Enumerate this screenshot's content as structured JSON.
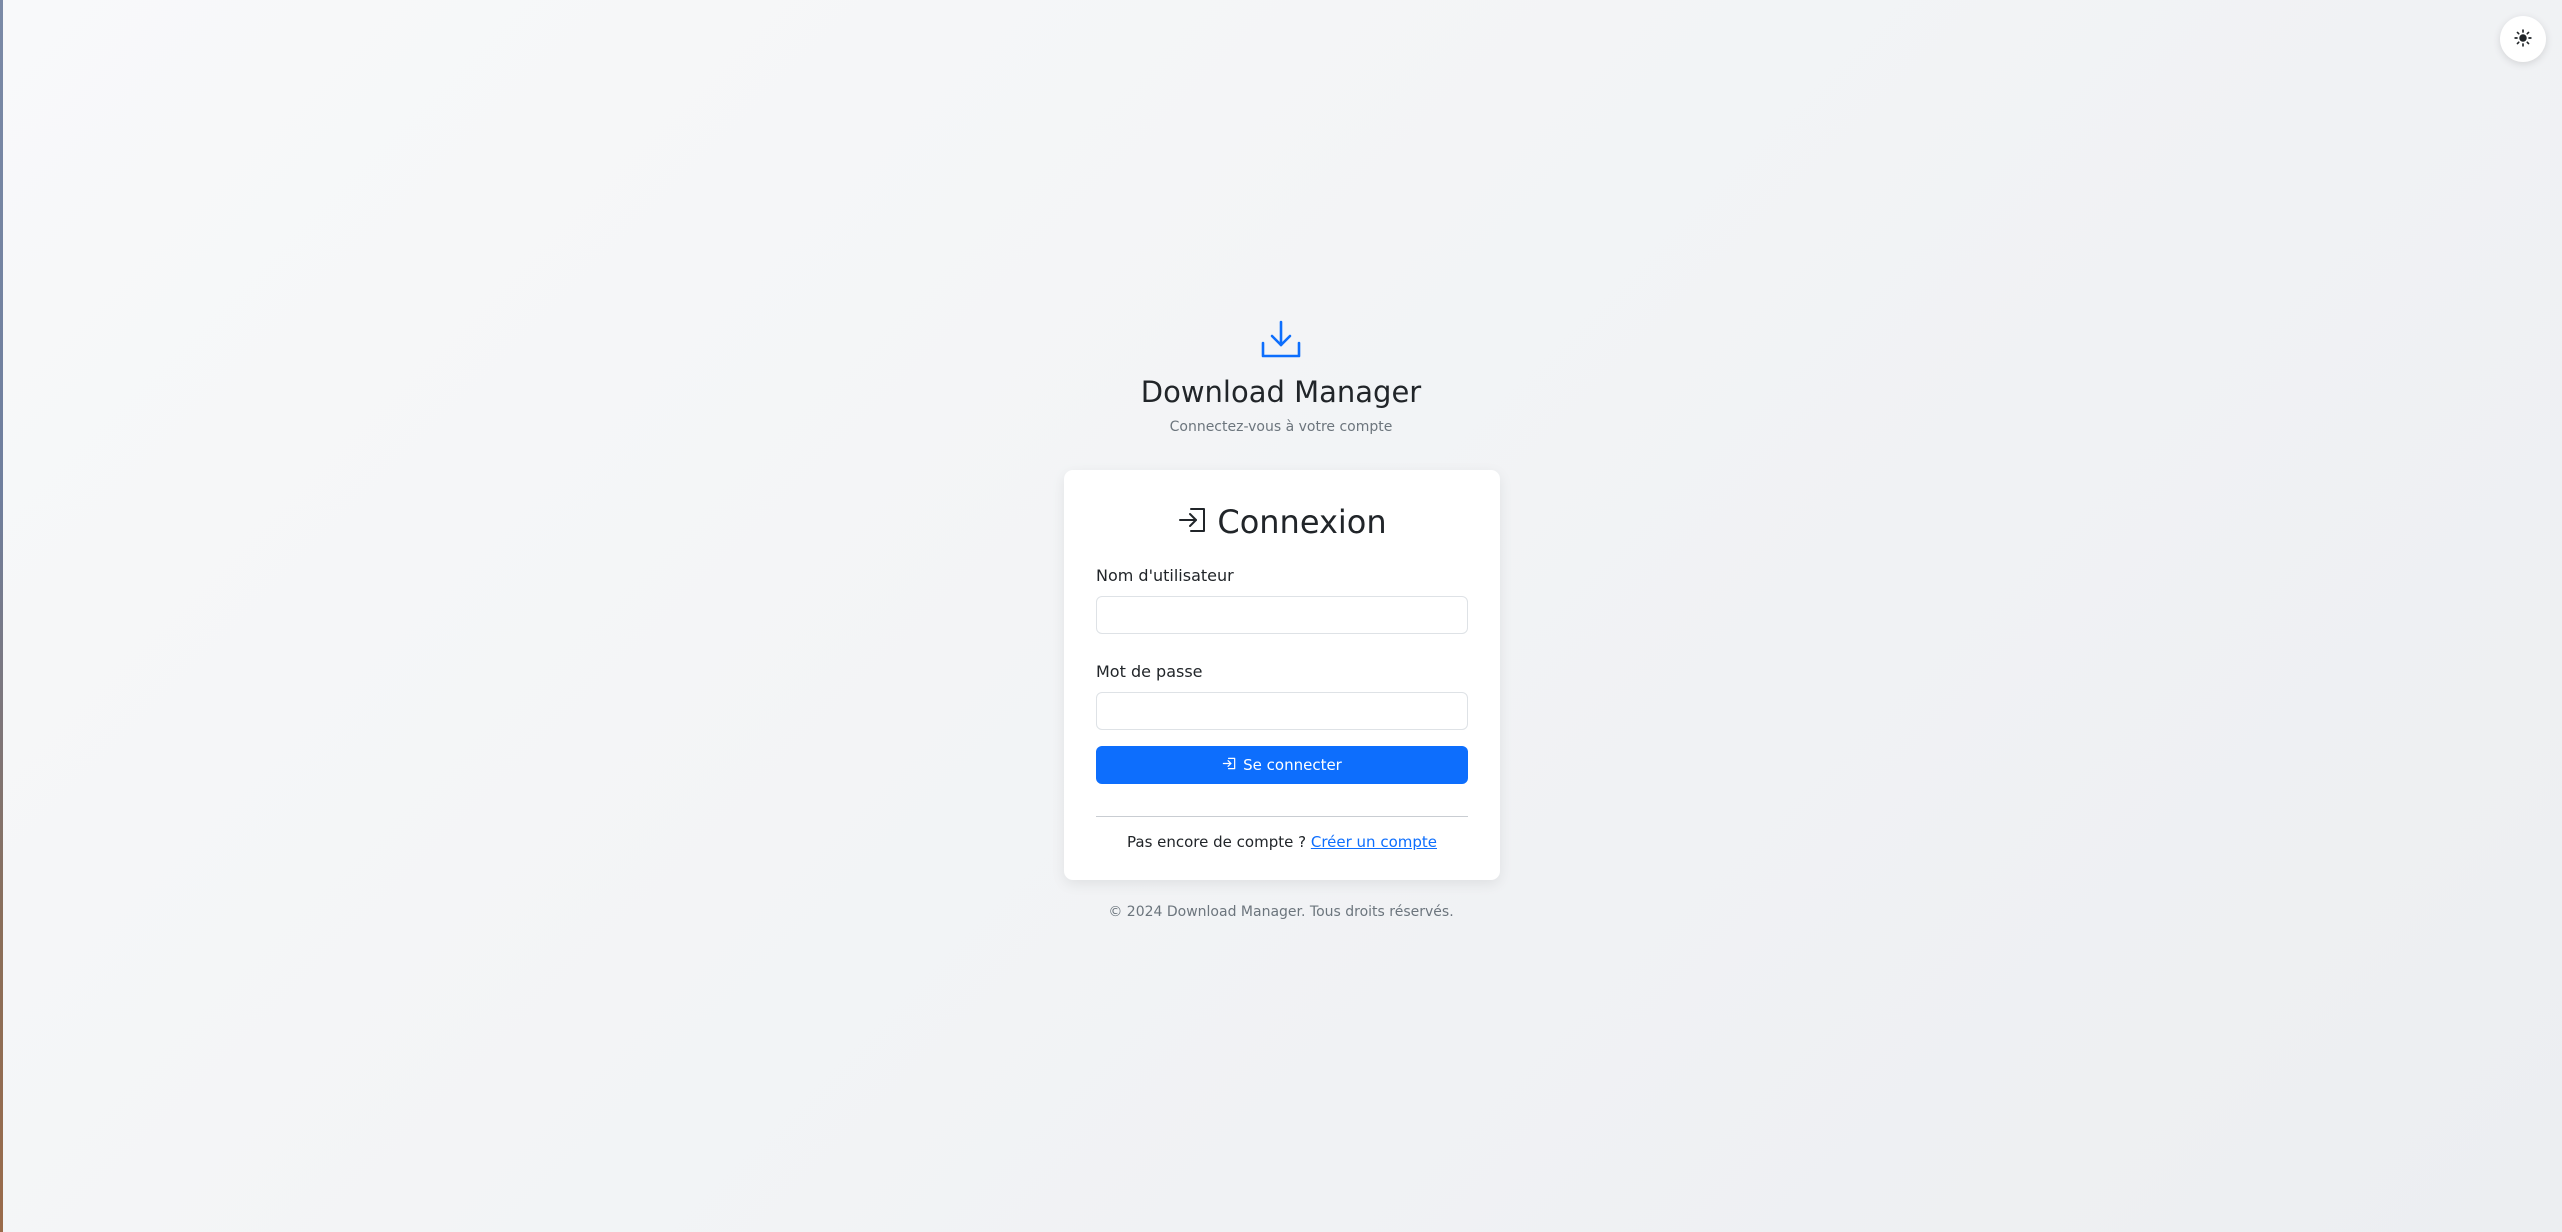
{
  "app": {
    "title": "Download Manager",
    "subtitle": "Connectez-vous à votre compte",
    "brand_icon": "download-icon"
  },
  "theme_toggle": {
    "icon": "sun-icon"
  },
  "login": {
    "heading": "Connexion",
    "heading_icon": "sign-in-icon",
    "username_label": "Nom d'utilisateur",
    "username_value": "",
    "password_label": "Mot de passe",
    "password_value": "",
    "submit_label": "Se connecter",
    "submit_icon": "sign-in-icon",
    "signup_prompt": "Pas encore de compte ?",
    "signup_link": "Créer un compte"
  },
  "footer": {
    "text": "© 2024 Download Manager. Tous droits réservés."
  },
  "colors": {
    "primary": "#0d6efd",
    "muted_text": "#6c757d",
    "background": "#f1f3f5"
  }
}
